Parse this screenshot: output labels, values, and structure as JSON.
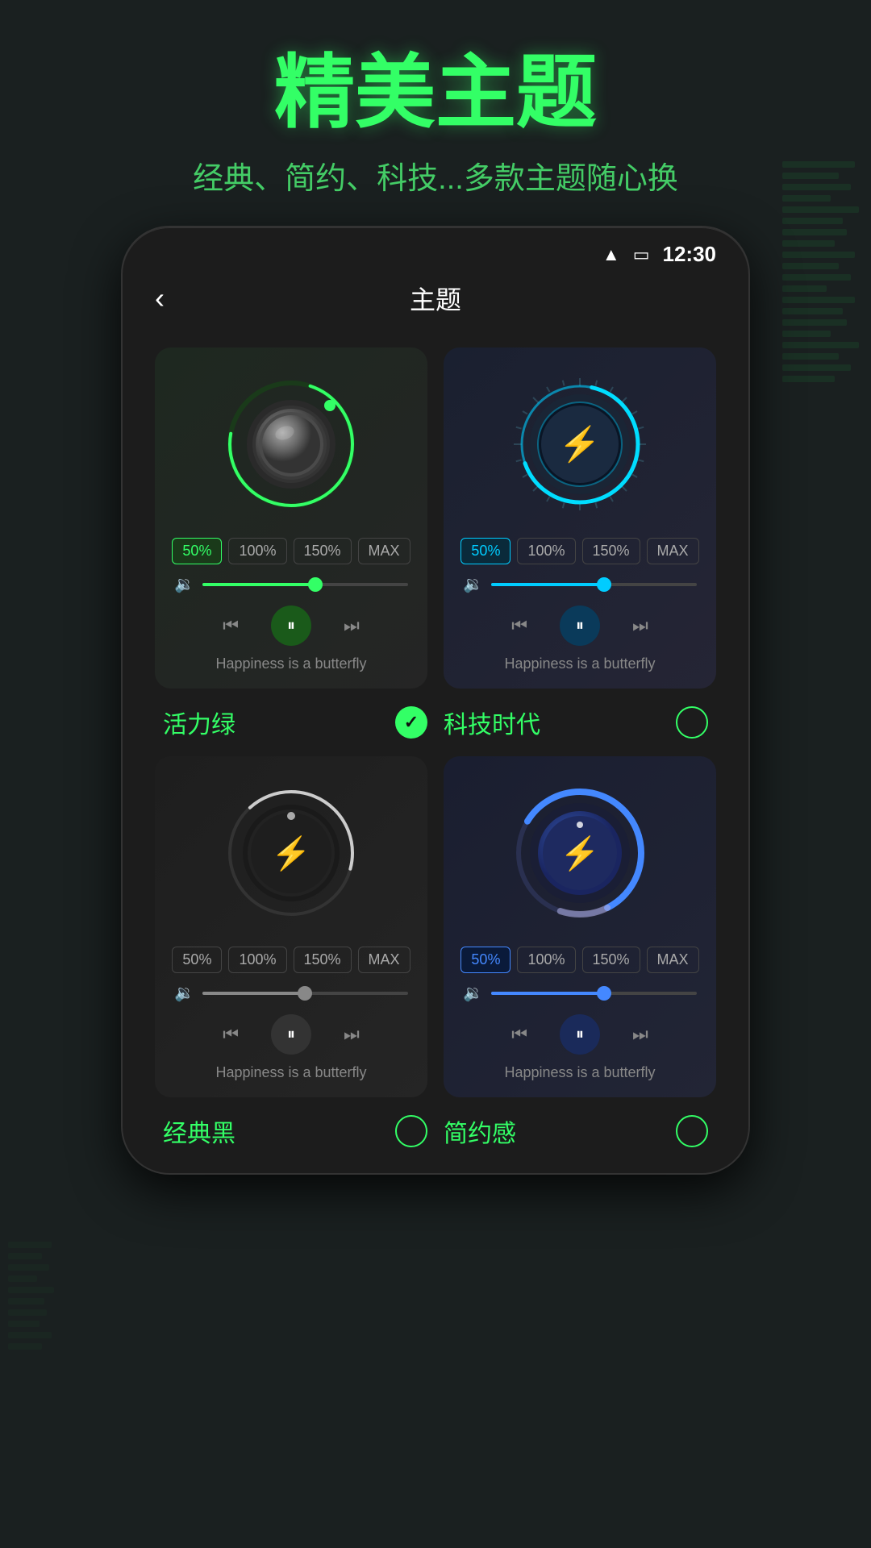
{
  "header": {
    "main_title": "精美主题",
    "sub_title": "经典、简约、科技...多款主题随心换"
  },
  "status_bar": {
    "time": "12:30"
  },
  "nav": {
    "title": "主题",
    "back_label": "‹"
  },
  "themes": [
    {
      "id": "vitality-green",
      "name": "活力绿",
      "selected": true,
      "type": "green",
      "song": "Happiness is a butterfly",
      "pct_buttons": [
        "50%",
        "100%",
        "150%",
        "MAX"
      ],
      "active_pct": 0
    },
    {
      "id": "tech-era",
      "name": "科技时代",
      "selected": false,
      "type": "cyan",
      "song": "Happiness is a butterfly",
      "pct_buttons": [
        "50%",
        "100%",
        "150%",
        "MAX"
      ],
      "active_pct": 0
    },
    {
      "id": "classic-black",
      "name": "经典黑",
      "selected": false,
      "type": "gray",
      "song": "Happiness is a butterfly",
      "pct_buttons": [
        "50%",
        "100%",
        "150%",
        "MAX"
      ],
      "active_pct": 0
    },
    {
      "id": "simple-feeling",
      "name": "简约感",
      "selected": false,
      "type": "blue",
      "song": "Happiness is a butterfly",
      "pct_buttons": [
        "50%",
        "100%",
        "150%",
        "MAX"
      ],
      "active_pct": 0
    }
  ]
}
